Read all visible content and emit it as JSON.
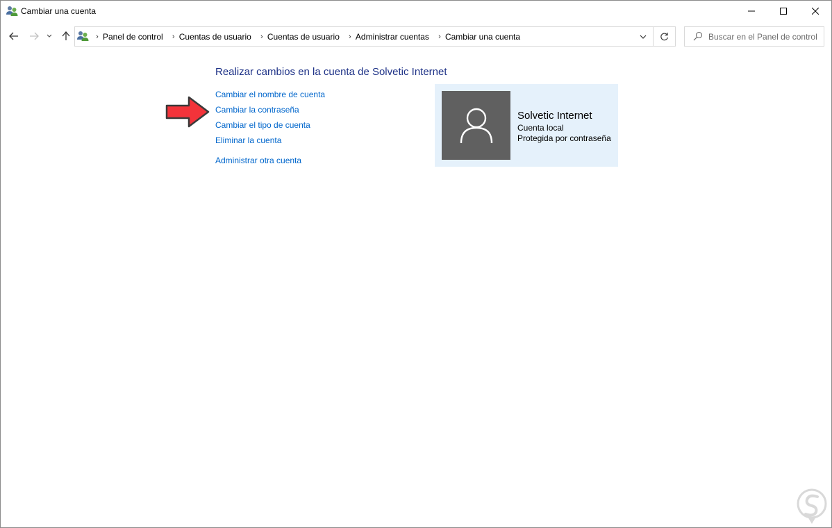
{
  "window": {
    "title": "Cambiar una cuenta",
    "icon": "user-accounts-icon",
    "controls": [
      "minimize-icon",
      "maximize-icon",
      "close-icon"
    ]
  },
  "nav": {
    "breadcrumbs": [
      "Panel de control",
      "Cuentas de usuario",
      "Cuentas de usuario",
      "Administrar cuentas",
      "Cambiar una cuenta"
    ],
    "search_placeholder": "Buscar en el Panel de control"
  },
  "content": {
    "heading": "Realizar cambios en la cuenta de Solvetic Internet",
    "tasks": [
      "Cambiar el nombre de cuenta",
      "Cambiar la contraseña",
      "Cambiar el tipo de cuenta",
      "Eliminar la cuenta"
    ],
    "other_task": "Administrar otra cuenta"
  },
  "account": {
    "name": "Solvetic Internet",
    "type": "Cuenta local",
    "status": "Protegida por contraseña"
  },
  "colors": {
    "link": "#0066cc",
    "heading": "#1e3287",
    "card_bg": "#e5f1fb",
    "avatar_bg": "#606060",
    "arrow": "#f2333a"
  }
}
